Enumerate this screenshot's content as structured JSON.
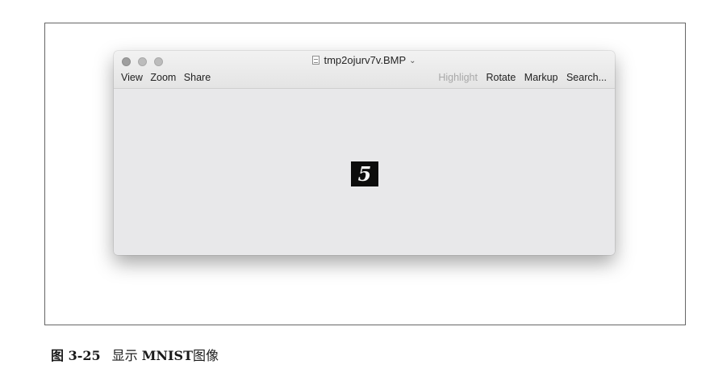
{
  "window": {
    "title": "tmp2ojurv7v.BMP",
    "chevron": "⌄",
    "toolbar_left": [
      "View",
      "Zoom",
      "Share"
    ],
    "toolbar_right": [
      {
        "label": "Highlight",
        "enabled": false
      },
      {
        "label": "Rotate",
        "enabled": true
      },
      {
        "label": "Markup",
        "enabled": true
      },
      {
        "label": "Search...",
        "enabled": true
      }
    ]
  },
  "content": {
    "digit": "5"
  },
  "caption": {
    "number": "图 3-25",
    "text_prefix": "显示 ",
    "text_bold": "MNIST",
    "text_suffix": "图像"
  },
  "icons": [
    "doc-icon",
    "chevron-down-icon"
  ],
  "colors": {
    "window_bg": "#e8e8e9",
    "digit_bg": "#0c0c0c",
    "disabled_text": "#a8a8a8"
  }
}
